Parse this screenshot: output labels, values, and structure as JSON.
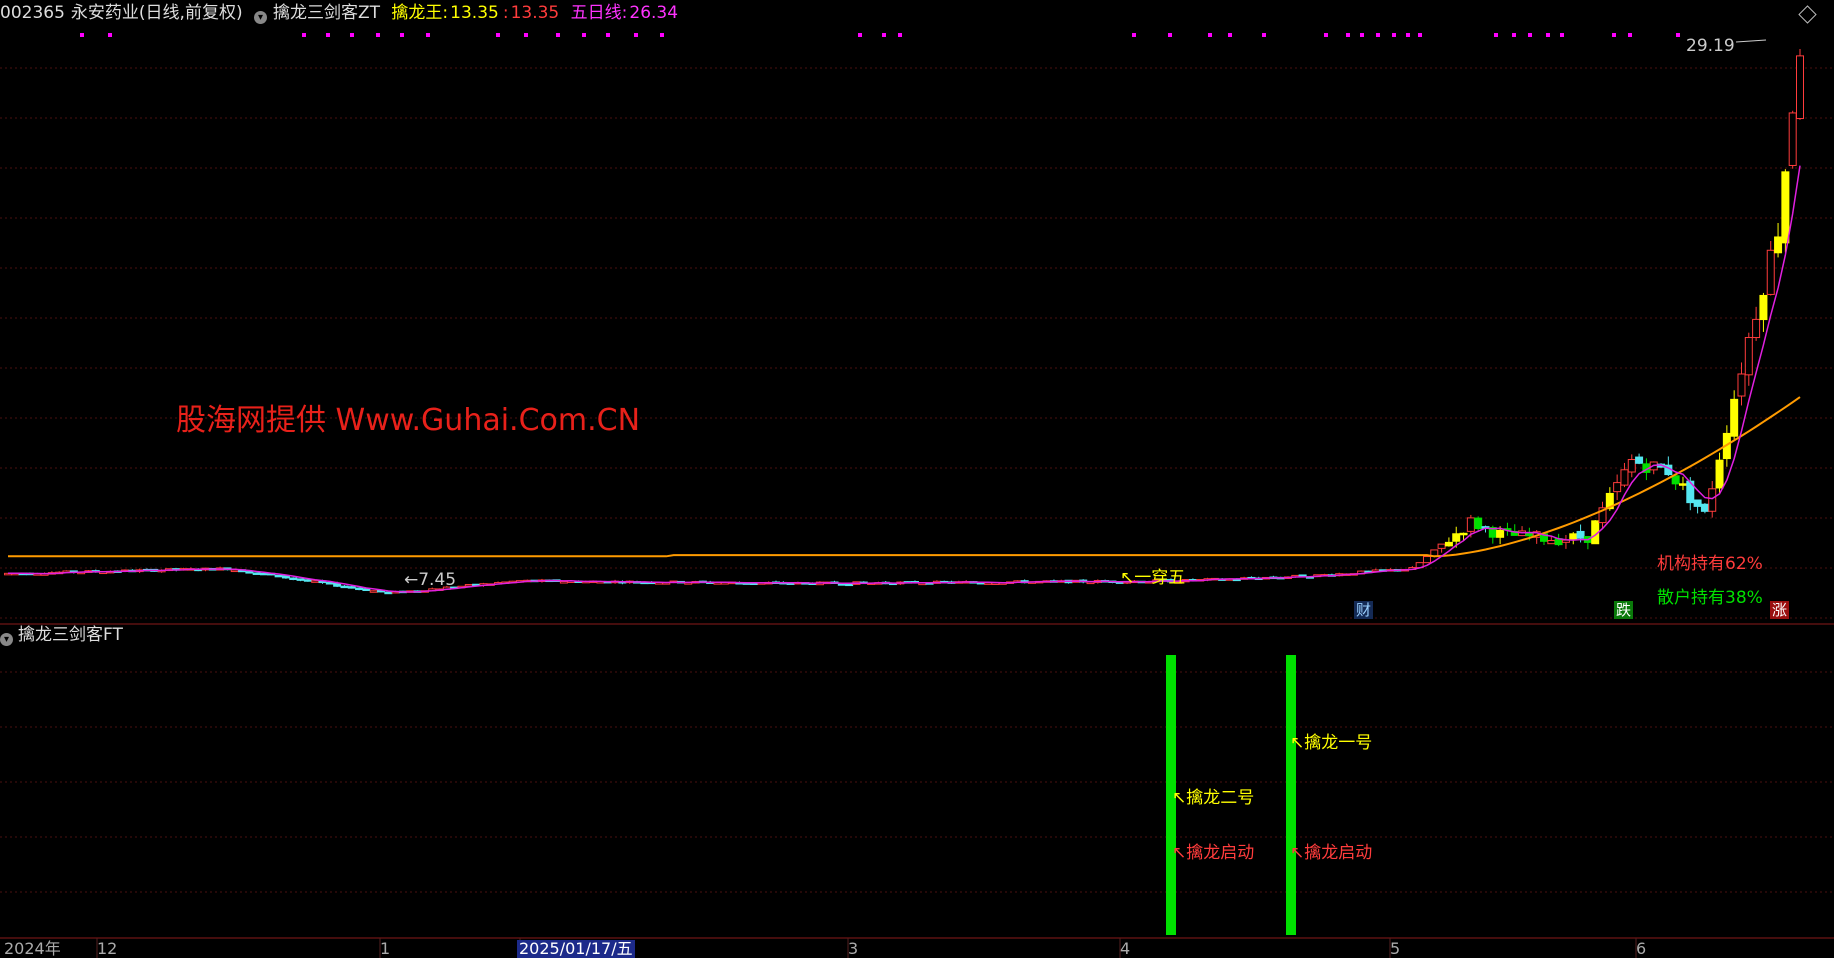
{
  "header": {
    "code": "002365",
    "name": "永安药业",
    "period": "(日线,前复权)",
    "indicator_name": "擒龙三剑客ZT",
    "label_king": "擒龙王:",
    "value_king_1": "13.35",
    "value_king_2": "13.35",
    "label_ma5": "五日线:",
    "value_ma5": "26.34"
  },
  "colors": {
    "up": "#ff3c3c",
    "down": "#55e6f0",
    "yellow": "#ffff00",
    "green": "#00e000",
    "ma5": "#e020e0",
    "long_ma": "#ff9b00",
    "grid": "#4a1010",
    "magenta_dots": "#ff00ff"
  },
  "watermark": "股海网提供 Www.Guhai.Com.CN",
  "annotations": {
    "low_price": "←7.45",
    "high_price": "29.19",
    "cross_five": "一穿五",
    "inst_hold": "机构持有62%",
    "retail_hold": "散户持有38%",
    "badge_cai": "财",
    "badge_die": "跌",
    "badge_zhang": "涨"
  },
  "indicator_panel": {
    "title": "擒龙三剑客FT",
    "sig_1_top": "擒龙二号",
    "sig_1_bottom": "擒龙启动",
    "sig_2_top": "擒龙一号",
    "sig_2_bottom": "擒龙启动"
  },
  "x_axis": {
    "labels": [
      "2024年",
      "12",
      "1",
      "2025/01/17/五",
      "3",
      "4",
      "5",
      "6"
    ]
  },
  "chart_data": {
    "type": "candlestick",
    "title": "",
    "ylim": [
      6.5,
      31
    ],
    "series_note": "daily candles, open/high/low/close in price units",
    "ma5_last": 26.34,
    "low_marker": 7.45,
    "high_marker": 29.19
  }
}
